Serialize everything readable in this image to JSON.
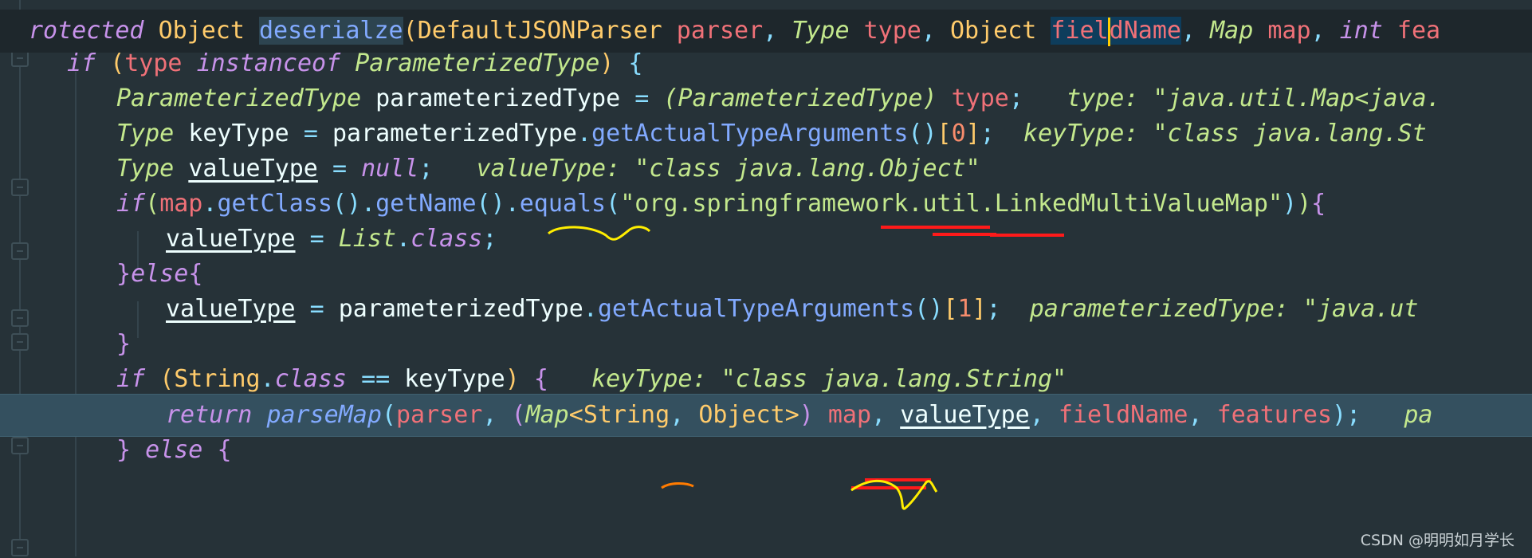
{
  "editor": {
    "theme_colors": {
      "background": "#263238",
      "keyword": "#c792ea",
      "type": "#ffcb6b",
      "italic_type": "#c3e88d",
      "method": "#82aaff",
      "parameter": "#f07178",
      "punctuation": "#89ddff",
      "string": "#c3e88d",
      "number": "#f78c6c",
      "current_line": "#34505f",
      "caret": "#ffcc00",
      "annotation_red": "#ff1a1a",
      "annotation_yellow": "#ffee00",
      "annotation_orange": "#ff7b00"
    },
    "gutter": {
      "intention_icon": "lightbulb-icon",
      "fold_icon": "fold-marker-icon"
    },
    "lines": [
      {
        "id": "signature",
        "tokens": {
          "t1": "rotected",
          "t2": "Object",
          "t3": "deserialze",
          "t4": "(",
          "t5": "DefaultJSONParser",
          "t6": "parser",
          "t7": ",",
          "t8": "Type",
          "t9": "type",
          "t10": ",",
          "t11": "Object",
          "t12a": "fiel",
          "t12b": "dName",
          "t13": ",",
          "t14": "Map",
          "t15": "map",
          "t16": ",",
          "t17": "int",
          "t18": "fea"
        }
      },
      {
        "id": "if-instanceof",
        "tokens": {
          "t1": "if",
          "t2": "(",
          "t3": "type",
          "t4": "instanceof",
          "t5": "ParameterizedType",
          "t6": ")",
          "t7": "{"
        }
      },
      {
        "id": "param-type-decl",
        "tokens": {
          "t1": "ParameterizedType",
          "t2": "parameterizedType",
          "t3": "=",
          "t4": "(",
          "t5": "ParameterizedType",
          "t6": ")",
          "t7": "type",
          "t8": ";"
        },
        "hint": "type: \"java.util.Map<java."
      },
      {
        "id": "key-type-decl",
        "tokens": {
          "t1": "Type",
          "t2": "keyType",
          "t3": "=",
          "t4": "parameterizedType",
          "t5": ".",
          "t6": "getActualTypeArguments",
          "t7": "()",
          "t8": "[",
          "t9": "0",
          "t10": "]",
          "t11": ";"
        },
        "hint": "keyType: \"class java.lang.St"
      },
      {
        "id": "value-type-decl",
        "tokens": {
          "t1": "Type",
          "t2": "valueType",
          "t3": "=",
          "t4": "null",
          "t5": ";"
        },
        "hint": "valueType: \"class java.lang.Object\""
      },
      {
        "id": "if-linked-multi",
        "tokens": {
          "t1": "if",
          "t2": "(",
          "t3": "map",
          "t4": ".",
          "t5": "getClass",
          "t6": "()",
          "t7": ".",
          "t8": "getName",
          "t9": "()",
          "t10": ".",
          "t11": "equals",
          "t12": "(",
          "t13": "\"org.springframework.util.LinkedMultiValueMap\"",
          "t14": ")",
          "t15": ")",
          "t16": "{"
        }
      },
      {
        "id": "value-type-list",
        "tokens": {
          "t1": "valueType",
          "t2": "=",
          "t3": "List",
          "t4": ".",
          "t5": "class",
          "t6": ";"
        }
      },
      {
        "id": "else",
        "tokens": {
          "t1": "}",
          "t2": "else",
          "t3": "{"
        }
      },
      {
        "id": "value-type-args",
        "tokens": {
          "t1": "valueType",
          "t2": "=",
          "t3": "parameterizedType",
          "t4": ".",
          "t5": "getActualTypeArguments",
          "t6": "()",
          "t7": "[",
          "t8": "1",
          "t9": "]",
          "t10": ";"
        },
        "hint": "parameterizedType: \"java.ut"
      },
      {
        "id": "close-brace",
        "tokens": {
          "t1": "}"
        }
      },
      {
        "id": "if-string-class",
        "tokens": {
          "t1": "if",
          "t2": "(",
          "t3": "String",
          "t4": ".",
          "t5": "class",
          "t6": "==",
          "t7": "keyType",
          "t8": ")",
          "t9": "{"
        },
        "hint": "keyType: \"class java.lang.String\""
      },
      {
        "id": "return-parse-map",
        "tokens": {
          "t1": "return",
          "t2": "parseMap",
          "t3": "(",
          "t4": "parser",
          "t5": ",",
          "t6": "(",
          "t7": "Map",
          "t8": "<",
          "t9": "String",
          "t10": ",",
          "t11": "Object",
          "t12": ">",
          "t13": ")",
          "t14": "map",
          "t15": ",",
          "t16": "valueType",
          "t17": ",",
          "t18": "fieldName",
          "t19": ",",
          "t20": "features",
          "t21": ")",
          "t22": ";"
        },
        "hint": "pa"
      },
      {
        "id": "else-branch",
        "tokens": {
          "t1": "}",
          "t2": "else",
          "t3": "{"
        }
      }
    ]
  },
  "watermark": "CSDN @明明如月学长"
}
